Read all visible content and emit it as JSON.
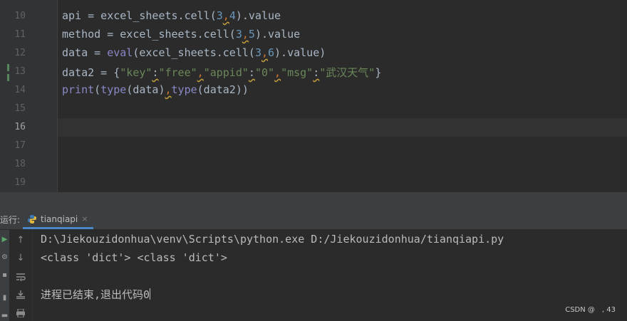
{
  "editor": {
    "line_numbers": [
      "10",
      "11",
      "12",
      "13",
      "14",
      "15",
      "16",
      "17",
      "18",
      "19"
    ],
    "current_line": "16",
    "lines": {
      "l10": {
        "a": "api = excel_sheets.cell(",
        "n1": "3",
        "c": ",",
        "n2": "4",
        "b": ").value"
      },
      "l11": {
        "a": "method = excel_sheets.cell(",
        "n1": "3",
        "c": ",",
        "n2": "5",
        "b": ").value"
      },
      "l12": {
        "a": "data = ",
        "fn": "eval",
        "m": "(excel_sheets.cell(",
        "n1": "3",
        "c": ",",
        "n2": "6",
        "b": ").value)"
      },
      "l13": {
        "a": "data2 = {",
        "k1": "\"key\"",
        "colon1": ":",
        "v1": "\"free\"",
        "c1": ",",
        "k2": "\"appid\"",
        "colon2": ":",
        "v2": "\"0\"",
        "c2": ",",
        "k3": "\"msg\"",
        "colon3": ":",
        "v3": "\"武汉天气\"",
        "b": "}"
      },
      "l14": {
        "fn1": "print",
        "p1": "(",
        "fn2": "type",
        "p2": "(data)",
        "c": ",",
        "fn3": "type",
        "p3": "(data2))"
      }
    }
  },
  "run_panel": {
    "label": "运行:",
    "tab_label": "tianqiapi",
    "tab_close": "×",
    "output": [
      "D:\\Jiekouzidonhua\\venv\\Scripts\\python.exe D:/Jiekouzidonhua/tianqiapi.py",
      "<class 'dict'> <class 'dict'>",
      "",
      "进程已结束,退出代码0"
    ],
    "icons": [
      "rerun-icon",
      "settings-icon",
      "up-arrow-icon",
      "down-arrow-icon",
      "soft-wrap-icon",
      "scroll-to-end-icon",
      "print-icon"
    ]
  },
  "watermark": "CSDN @　, 43",
  "colors": {
    "accent": "#4a88c7",
    "background": "#2b2b2b",
    "number": "#6897bb",
    "string": "#6a8759"
  }
}
